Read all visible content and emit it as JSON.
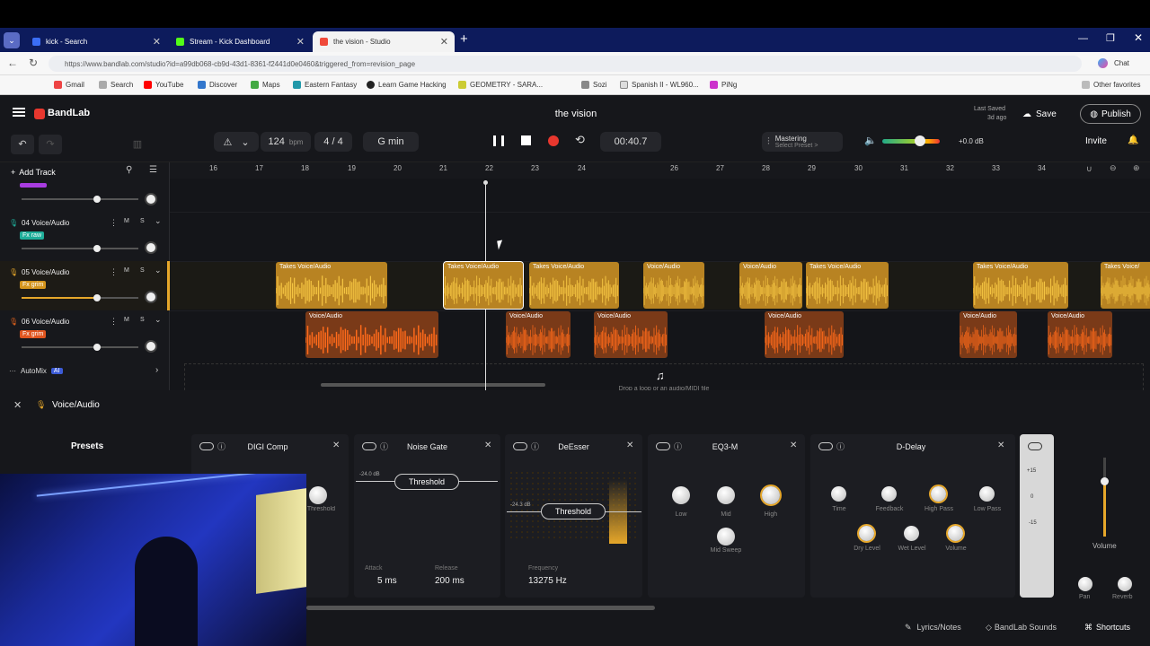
{
  "browser": {
    "tabs": [
      {
        "label": "kick - Search",
        "color": "#3b6ef5"
      },
      {
        "label": "Stream - Kick Dashboard",
        "color": "#53fc18"
      },
      {
        "label": "the vision - Studio",
        "color": "#f04a3a"
      }
    ],
    "url": "https://www.bandlab.com/studio?id=a99db068-cb9d-43d1-8361-f2441d0e0460&triggered_from=revision_page",
    "chat_label": "Chat",
    "favorites": [
      "Gmail",
      "Search",
      "YouTube",
      "Discover",
      "Maps",
      "Eastern Fantasy",
      "Learn Game Hacking",
      "GEOMETRY - SARA...",
      "Sozi",
      "Spanish II - WL960...",
      "PiNg"
    ],
    "other_favorites": "Other favorites"
  },
  "app": {
    "brand": "BandLab",
    "project_title": "the vision",
    "last_saved": "Last Saved",
    "last_saved_ago": "3d ago",
    "save_label": "Save",
    "publish_label": "Publish",
    "invite_label": "Invite"
  },
  "transport": {
    "bpm": "124",
    "bpm_unit": "bpm",
    "time_sig": "4 / 4",
    "key": "G min",
    "time": "00:40.7",
    "mastering_title": "Mastering",
    "mastering_preset": "Select Preset >",
    "master_db": "+0.0 dB"
  },
  "toolbar": {
    "add_track": "Add Track"
  },
  "ruler": [
    "16",
    "17",
    "18",
    "19",
    "20",
    "21",
    "22",
    "23",
    "24",
    "26",
    "27",
    "28",
    "29",
    "30",
    "31",
    "32",
    "33",
    "34"
  ],
  "tracks": [
    {
      "name": "04 Voice/Audio",
      "fx": "Fx raw",
      "fxcolor": "#1fae9a"
    },
    {
      "name": "05 Voice/Audio",
      "fx": "Fx grim",
      "fxcolor": "#d4941c"
    },
    {
      "name": "06 Voice/Audio",
      "fx": "Fx grim",
      "fxcolor": "#e0551f"
    }
  ],
  "clip_labels": {
    "takes": "Takes",
    "voice": "Voice/Audio",
    "voice_short": "Voice/"
  },
  "automix": {
    "label": "AutoMix",
    "badge": "AI"
  },
  "drop_hint": "Drop a loop or an audio/MIDI file",
  "fx_panel": {
    "track_label": "Voice/Audio",
    "presets_label": "Presets",
    "effects": [
      {
        "name": "DIGI Comp",
        "controls": [
          "Threshold"
        ]
      },
      {
        "name": "Noise Gate",
        "threshold_db": "-24.0 dB",
        "threshold_label": "Threshold",
        "attack_label": "Attack",
        "attack": "5 ms",
        "release_label": "Release",
        "release": "200 ms"
      },
      {
        "name": "DeEsser",
        "threshold_db": "-24.3 dB",
        "threshold_label": "Threshold",
        "freq_label": "Frequency",
        "freq": "13275 Hz"
      },
      {
        "name": "EQ3-M",
        "controls": [
          "Low",
          "Mid",
          "High",
          "Mid Sweep"
        ]
      },
      {
        "name": "D-Delay",
        "controls": [
          "Time",
          "Feedback",
          "High Pass",
          "Low Pass",
          "Dry Level",
          "Wet Level",
          "Volume"
        ]
      }
    ],
    "meter_ticks": [
      "+15",
      "0",
      "-15"
    ],
    "volume_label": "Volume",
    "pan_label": "Pan",
    "reverb_label": "Reverb"
  },
  "bottom": {
    "lyrics": "Lyrics/Notes",
    "sounds": "BandLab Sounds",
    "shortcuts": "Shortcuts"
  },
  "colors": {
    "accent": "#e8372e",
    "yellow": "#e6a72a",
    "orange": "#e0621c"
  }
}
